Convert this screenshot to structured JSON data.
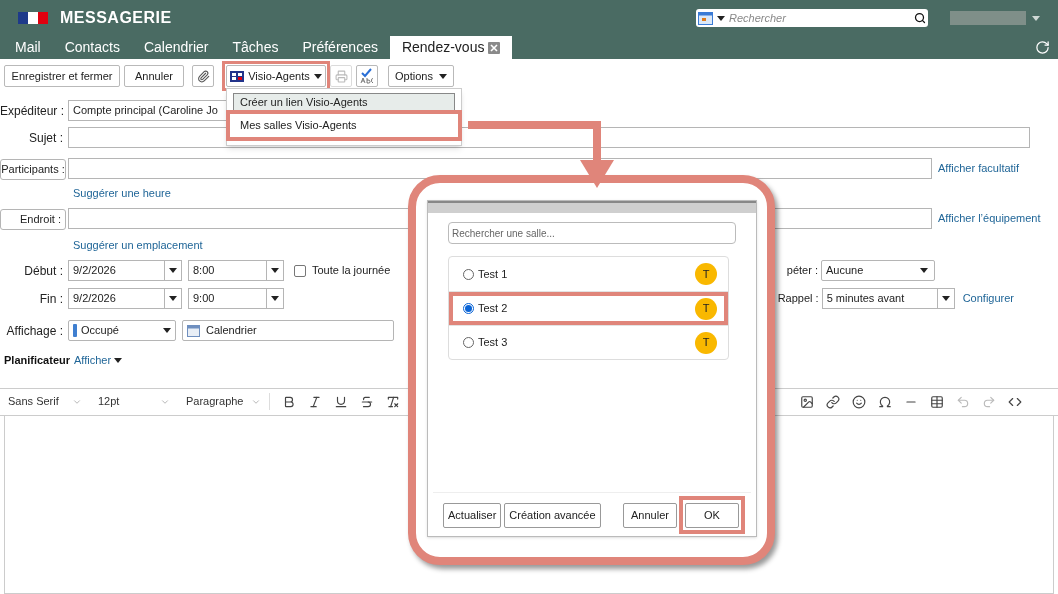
{
  "header": {
    "title": "MESSAGERIE",
    "search": {
      "placeholder": "Rechercher"
    }
  },
  "tabs": [
    {
      "label": "Mail",
      "selected": false,
      "closable": false
    },
    {
      "label": "Contacts",
      "selected": false,
      "closable": false
    },
    {
      "label": "Calendrier",
      "selected": false,
      "closable": false
    },
    {
      "label": "Tâches",
      "selected": false,
      "closable": false
    },
    {
      "label": "Préférences",
      "selected": false,
      "closable": false
    },
    {
      "label": "Rendez-vous",
      "selected": true,
      "closable": true
    }
  ],
  "toolbar": {
    "save": "Enregistrer et fermer",
    "cancel": "Annuler",
    "visio": {
      "label": "Visio-Agents",
      "highlighted": true
    },
    "print": {
      "disabled": true
    },
    "options": "Options"
  },
  "menu": {
    "items": [
      {
        "label": "Créer un lien Visio-Agents",
        "hovered": true,
        "highlighted": false
      },
      {
        "label": "Mes salles Visio-Agents",
        "hovered": false,
        "highlighted": true
      }
    ]
  },
  "form": {
    "sender": {
      "label": "Expéditeur :",
      "value": "Compte principal (Caroline Jo"
    },
    "subject": {
      "label": "Sujet :"
    },
    "participants": {
      "label": "Participants :",
      "link": "Afficher facultatif"
    },
    "suggest_time": "Suggérer une heure",
    "location": {
      "label": "Endroit :",
      "link": "Afficher l’équipement"
    },
    "suggest_location": "Suggérer un emplacement",
    "start": {
      "label": "Début :",
      "date": "9/2/2026",
      "time": "8:00"
    },
    "all_day": {
      "label": "Toute la journée",
      "checked": false
    },
    "repeat": {
      "label": "péter :",
      "value": "Aucune"
    },
    "end": {
      "label": "Fin :",
      "date": "9/2/2026",
      "time": "9:00"
    },
    "reminder": {
      "label": "Rappel :",
      "value": "5 minutes avant",
      "link": "Configurer"
    },
    "display": {
      "label": "Affichage :",
      "status": "Occupé",
      "calendar": "Calendrier"
    },
    "scheduler": {
      "label": "Planificateur",
      "link": "Afficher"
    }
  },
  "editor": {
    "font": "Sans Serif",
    "size": "12pt",
    "block": "Paragraphe"
  },
  "dialog": {
    "search": {
      "placeholder": "Rechercher une salle..."
    },
    "rooms": [
      {
        "name": "Test 1",
        "initial": "T",
        "selected": false,
        "highlighted": false
      },
      {
        "name": "Test 2",
        "initial": "T",
        "selected": true,
        "highlighted": true
      },
      {
        "name": "Test 3",
        "initial": "T",
        "selected": false,
        "highlighted": false
      }
    ],
    "left_buttons": [
      {
        "label": "Actualiser",
        "highlighted": false
      },
      {
        "label": "Création avancée",
        "highlighted": false
      }
    ],
    "right_buttons": [
      {
        "label": "Annuler",
        "highlighted": false
      },
      {
        "label": "OK",
        "highlighted": true
      }
    ]
  }
}
